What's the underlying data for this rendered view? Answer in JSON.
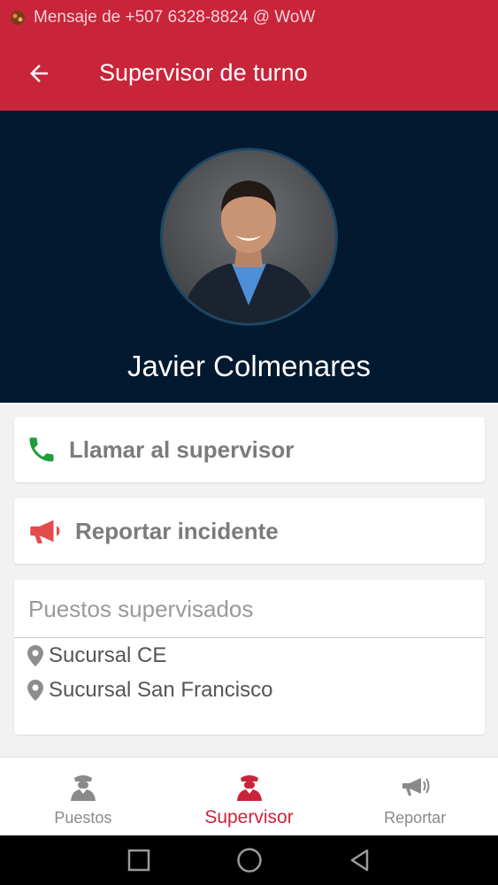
{
  "status_bar": {
    "notification": "Mensaje de +507 6328-8824 @ WoW"
  },
  "app_bar": {
    "title": "Supervisor de turno"
  },
  "supervisor": {
    "name": "Javier Colmenares"
  },
  "actions": {
    "call_label": "Llamar al supervisor",
    "report_label": "Reportar incidente"
  },
  "posts": {
    "title": "Puestos supervisados",
    "items": [
      "Sucursal CE",
      "Sucursal San Francisco"
    ]
  },
  "bottom_nav": {
    "items": [
      {
        "label": "Puestos",
        "icon": "guard-icon"
      },
      {
        "label": "Supervisor",
        "icon": "supervisor-icon",
        "active": true
      },
      {
        "label": "Reportar",
        "icon": "megaphone-icon"
      }
    ]
  },
  "colors": {
    "primary": "#c8243a",
    "hero_bg": "#02192f",
    "call_green": "#1e9e3e",
    "report_red": "#e44b4b",
    "nav_inactive": "#8a8a8a"
  }
}
